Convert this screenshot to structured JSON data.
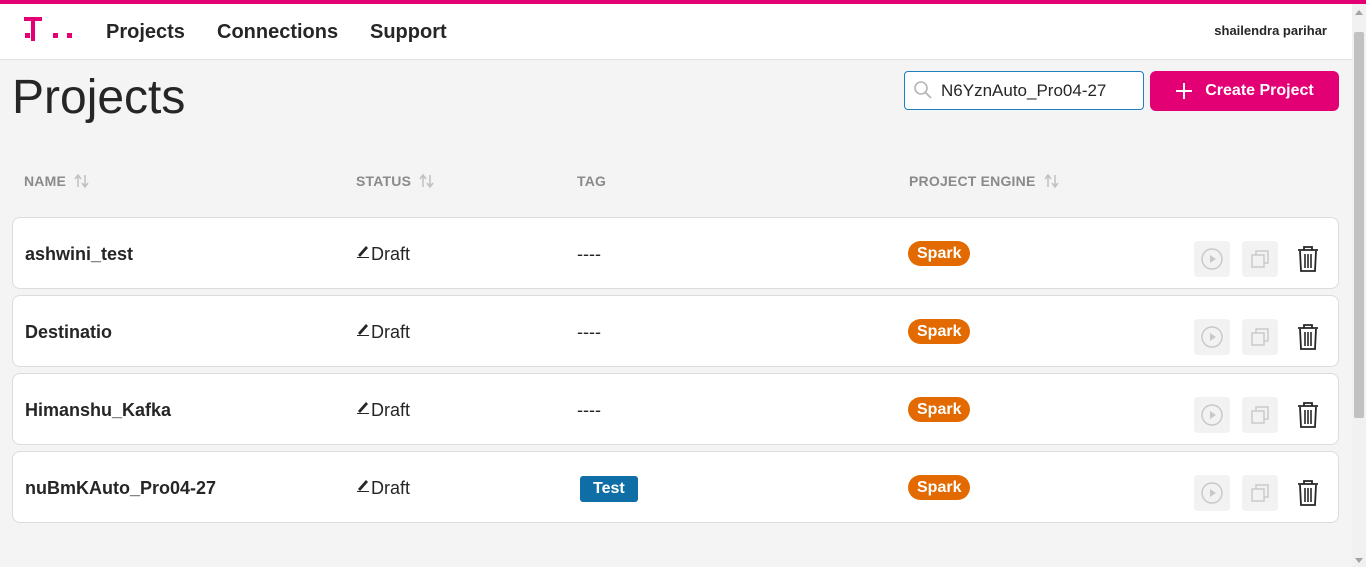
{
  "brand": {
    "accent": "#e20074"
  },
  "nav": {
    "items": [
      {
        "label": "Projects"
      },
      {
        "label": "Connections"
      },
      {
        "label": "Support"
      }
    ],
    "user_name": "shailendra parihar"
  },
  "page": {
    "title": "Projects"
  },
  "search": {
    "value": "N6YznAuto_Pro04-27",
    "icon": "search-icon"
  },
  "create_button": {
    "label": "Create Project",
    "icon": "plus-icon"
  },
  "table": {
    "columns": [
      {
        "label": "NAME",
        "sortable": true
      },
      {
        "label": "STATUS",
        "sortable": true
      },
      {
        "label": "TAG",
        "sortable": false
      },
      {
        "label": "PROJECT ENGINE",
        "sortable": true
      }
    ],
    "rows": [
      {
        "name": "ashwini_test",
        "status": "Draft",
        "tag": "----",
        "tag_badge": null,
        "engine": "Spark"
      },
      {
        "name": "Destinatio",
        "status": "Draft",
        "tag": "----",
        "tag_badge": null,
        "engine": "Spark"
      },
      {
        "name": "Himanshu_Kafka",
        "status": "Draft",
        "tag": "----",
        "tag_badge": null,
        "engine": "Spark"
      },
      {
        "name": "nuBmKAuto_Pro04-27",
        "status": "Draft",
        "tag": null,
        "tag_badge": "Test",
        "engine": "Spark"
      }
    ],
    "row_actions": [
      "play-icon",
      "copy-icon",
      "trash-icon"
    ]
  },
  "colors": {
    "engine_badge": "#e26a00",
    "tag_badge": "#0f6ea5",
    "search_border": "#1e7fbf"
  }
}
